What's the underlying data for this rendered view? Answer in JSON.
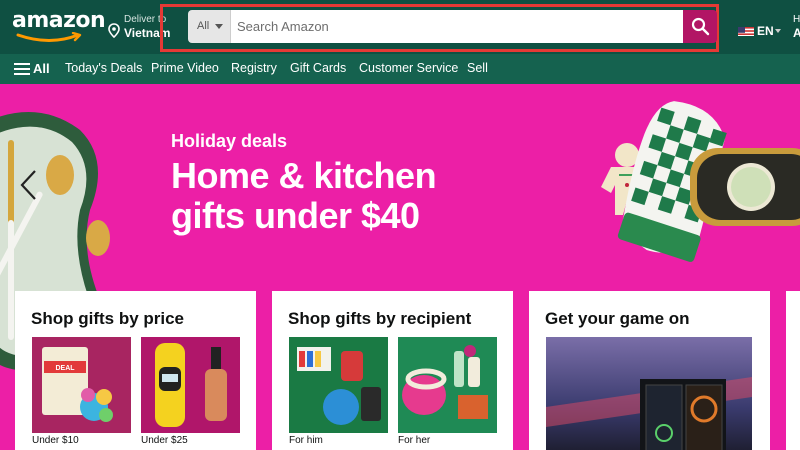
{
  "header": {
    "logo_text": "amazon",
    "deliver_to_label": "Deliver to",
    "deliver_to_location": "Vietnam",
    "search_category": "All",
    "search_placeholder": "Search Amazon",
    "language": "EN",
    "account_line1_partial": "H",
    "account_line2_partial": "A"
  },
  "nav": {
    "all_label": "All",
    "items": [
      "Today's Deals",
      "Prime Video",
      "Registry",
      "Gift Cards",
      "Customer Service",
      "Sell"
    ]
  },
  "hero": {
    "tag": "Holiday deals",
    "title": "Home & kitchen gifts under $40"
  },
  "cards": [
    {
      "title": "Shop gifts by price",
      "tiles": [
        {
          "caption": "Under $10",
          "image": "monopoly-deal-and-fidget-toy"
        },
        {
          "caption": "Under $25",
          "image": "yellow-watch-and-nail-polish"
        }
      ]
    },
    {
      "title": "Shop gifts by recipient",
      "tiles": [
        {
          "caption": "For him",
          "image": "mens-gift-set"
        },
        {
          "caption": "For her",
          "image": "womens-gift-set"
        }
      ]
    },
    {
      "title": "Get your game on",
      "tiles": [
        {
          "caption": "",
          "image": "gaming-pc-tower"
        }
      ]
    }
  ],
  "colors": {
    "header_bg": "#0f5042",
    "nav_bg": "#15624f",
    "hero_bg": "#ec1fa6",
    "search_button": "#b21565",
    "highlight_border": "#e53935"
  },
  "icons": [
    "location-pin-icon",
    "search-icon",
    "caret-down-icon",
    "hamburger-menu-icon",
    "chevron-left-icon",
    "us-flag-icon"
  ]
}
